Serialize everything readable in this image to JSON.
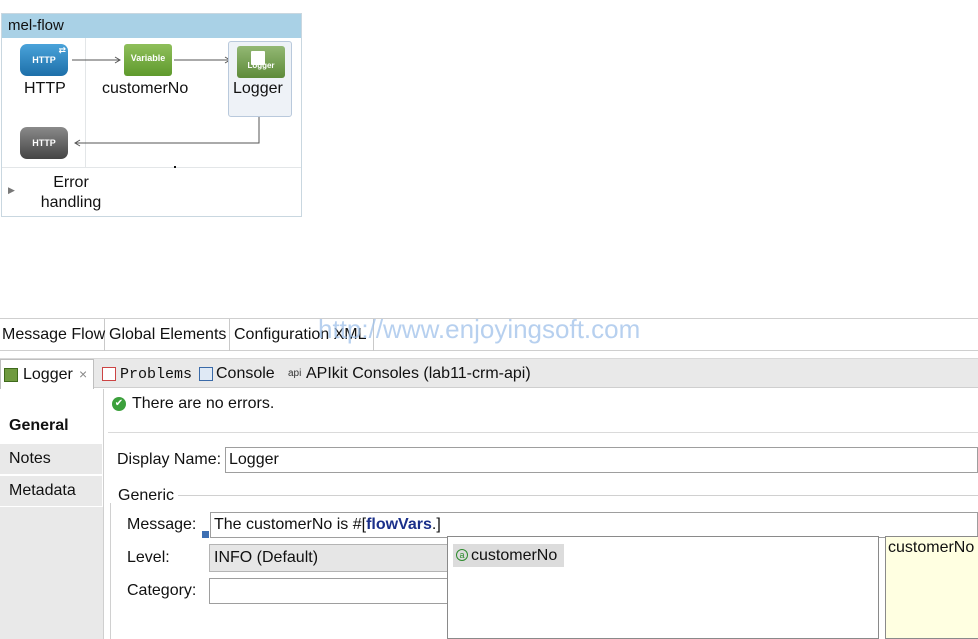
{
  "flow": {
    "title": "mel-flow",
    "nodes": {
      "http_label": "HTTP",
      "http_icon_text": "HTTP",
      "variable_icon_text": "Variable",
      "variable_label": "customerNo",
      "logger_icon_text": "Logger",
      "logger_label": "Logger",
      "http_response_icon_text": "HTTP"
    },
    "error_handling_label": "Error handling"
  },
  "editor_tabs": {
    "message_flow": "Message Flow",
    "global_elements": "Global Elements",
    "configuration_xml": "Configuration XML"
  },
  "watermark": "http://www.enjoyingsoft.com",
  "panel_tabs": {
    "logger": "Logger",
    "problems": "Problems",
    "console": "Console",
    "apikit_tag": "api",
    "apikit": "APIkit Consoles (lab11-crm-api)"
  },
  "side_nav": {
    "general": "General",
    "notes": "Notes",
    "metadata": "Metadata"
  },
  "status": "There are no errors.",
  "form": {
    "display_name_label": "Display Name:",
    "display_name_value": "Logger",
    "group_label": "Generic",
    "message_label": "Message:",
    "message_prefix": "The customerNo is #[",
    "message_keyword": "flowVars",
    "message_suffix": ".]",
    "level_label": "Level:",
    "level_value": "INFO (Default)",
    "category_label": "Category:",
    "category_value": ""
  },
  "autocomplete": {
    "item_icon": "a",
    "item": "customerNo",
    "detail": "customerNo"
  },
  "colors": {
    "flow_title_bg": "#a9d1e6",
    "http_blue": "#1d6fa9",
    "variable_green": "#5f9a2d",
    "status_ok": "#3ca03c",
    "keyword_blue": "#1a2f8a",
    "tooltip_bg": "#ffffe1"
  }
}
